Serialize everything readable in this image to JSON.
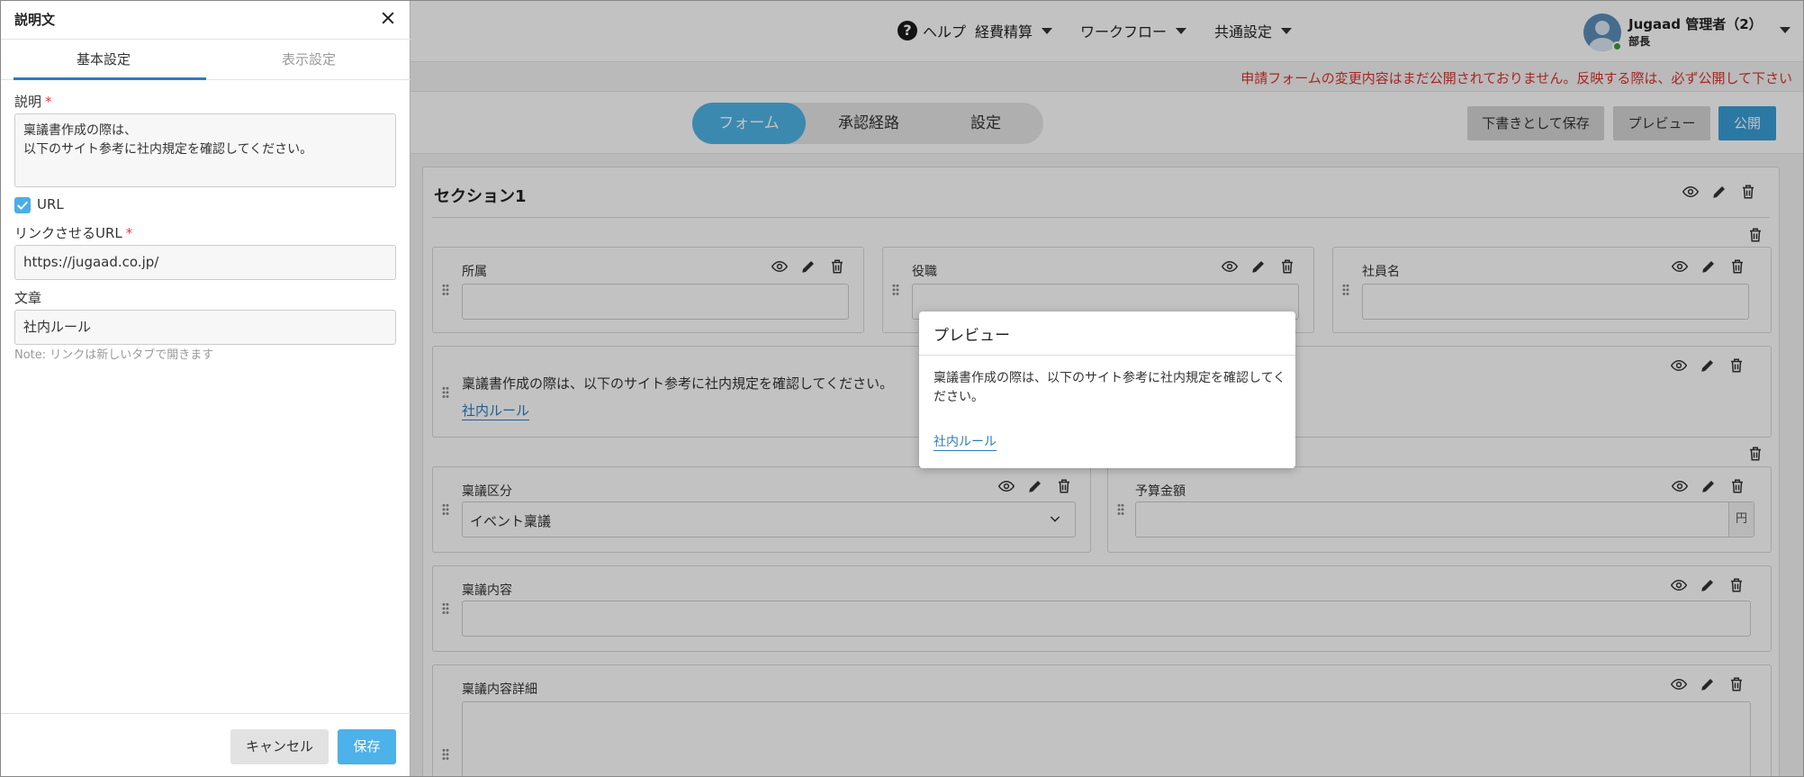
{
  "header": {
    "help_label": "ヘルプ",
    "nav": [
      {
        "label": "経費精算"
      },
      {
        "label": "ワークフロー"
      },
      {
        "label": "共通設定"
      }
    ],
    "user_name": "Jugaad 管理者（2）",
    "user_role": "部長"
  },
  "notice": "申請フォームの変更内容はまだ公開されておりません。反映する際は、必ず公開して下さい",
  "toolbar": {
    "tabs": [
      {
        "label": "フォーム",
        "active": true
      },
      {
        "label": "承認経路",
        "active": false
      },
      {
        "label": "設定",
        "active": false
      }
    ],
    "draft_save": "下書きとして保存",
    "preview": "プレビュー",
    "publish": "公開"
  },
  "form": {
    "section_title": "セクション1",
    "fields": {
      "affiliation": "所属",
      "position": "役職",
      "employee_name": "社員名",
      "ringi_type": "稟議区分",
      "ringi_type_value": "イベント稟議",
      "budget": "予算金額",
      "budget_unit": "円",
      "ringi_content": "稟議内容",
      "ringi_detail": "稟議内容詳細"
    },
    "description_block": {
      "text": "稟議書作成の際は、以下のサイト参考に社内規定を確認してください。",
      "link_text": "社内ルール"
    }
  },
  "popup": {
    "title": "プレビュー",
    "text": "稟議書作成の際は、以下のサイト参考に社内規定を確認してください。",
    "link_text": "社内ルール"
  },
  "panel": {
    "title": "説明文",
    "tabs": {
      "basic": "基本設定",
      "display": "表示設定"
    },
    "description_label": "説明",
    "description_line1": "稟議書作成の際は、",
    "description_line2": "以下のサイト参考に社内規定を確認してください。",
    "url_checkbox_label": "URL",
    "url_checked": true,
    "link_url_label": "リンクさせるURL",
    "link_url_value": "https://jugaad.co.jp/",
    "text_label": "文章",
    "text_value": "社内ルール",
    "note": "Note: リンクは新しいタブで開きます",
    "cancel": "キャンセル",
    "save": "保存"
  },
  "colors": {
    "accent": "#4fb4e7",
    "publish": "#3a9ed8",
    "notice": "#d9322e",
    "link": "#2a7cc0",
    "required": "#e03b3b"
  },
  "icons": [
    "help-icon",
    "caret-down-icon",
    "eye-icon",
    "pencil-icon",
    "trash-icon",
    "drag-handle-icon",
    "close-icon",
    "checkbox-check-icon",
    "chevron-down-icon"
  ]
}
